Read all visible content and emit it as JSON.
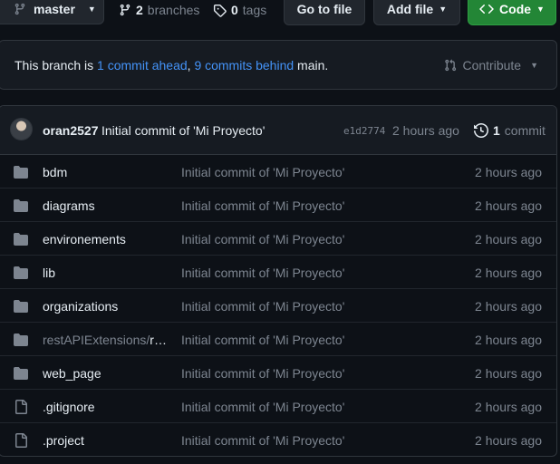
{
  "toolbar": {
    "branch": "master",
    "branches_count": "2",
    "branches_label": "branches",
    "tags_count": "0",
    "tags_label": "tags",
    "go_to_file": "Go to file",
    "add_file": "Add file",
    "code": "Code"
  },
  "branch_info": {
    "prefix": "This branch is ",
    "ahead": "1 commit ahead",
    "sep": ", ",
    "behind": "9 commits behind",
    "suffix": " main.",
    "contribute": "Contribute"
  },
  "latest_commit": {
    "author": "oran2527",
    "message": "Initial commit of 'Mi Proyecto'",
    "sha": "e1d2774",
    "time": "2 hours ago",
    "count": "1",
    "count_label": "commit"
  },
  "files": [
    {
      "type": "dir",
      "name": "bdm",
      "message": "Initial commit of 'Mi Proyecto'",
      "time": "2 hours ago"
    },
    {
      "type": "dir",
      "name": "diagrams",
      "message": "Initial commit of 'Mi Proyecto'",
      "time": "2 hours ago"
    },
    {
      "type": "dir",
      "name": "environements",
      "message": "Initial commit of 'Mi Proyecto'",
      "time": "2 hours ago"
    },
    {
      "type": "dir",
      "name": "lib",
      "message": "Initial commit of 'Mi Proyecto'",
      "time": "2 hours ago"
    },
    {
      "type": "dir",
      "name": "organizations",
      "message": "Initial commit of 'Mi Proyecto'",
      "time": "2 hours ago"
    },
    {
      "type": "dir",
      "name_dim": "restAPIExtensions/",
      "name": "re…",
      "message": "Initial commit of 'Mi Proyecto'",
      "time": "2 hours ago"
    },
    {
      "type": "dir",
      "name": "web_page",
      "message": "Initial commit of 'Mi Proyecto'",
      "time": "2 hours ago"
    },
    {
      "type": "file",
      "name": ".gitignore",
      "message": "Initial commit of 'Mi Proyecto'",
      "time": "2 hours ago"
    },
    {
      "type": "file",
      "name": ".project",
      "message": "Initial commit of 'Mi Proyecto'",
      "time": "2 hours ago"
    }
  ],
  "colors": {
    "background": "#0d1117",
    "link": "#4493f8",
    "code_button": "#238636",
    "muted": "#7d8590"
  }
}
